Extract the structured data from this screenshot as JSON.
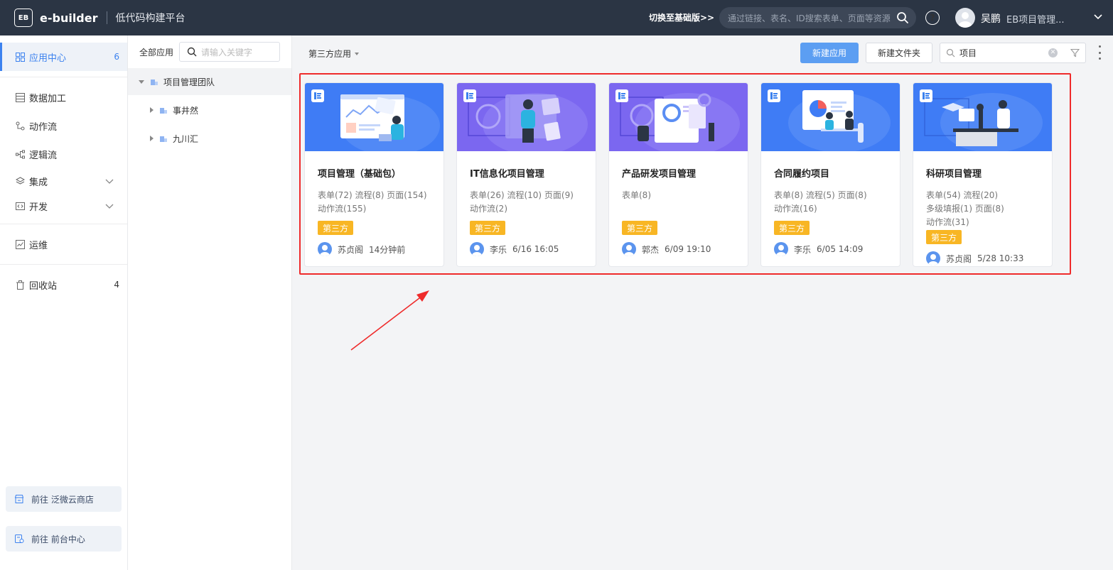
{
  "topbar": {
    "logo_text": "EB",
    "brand": "e-builder",
    "subtitle": "低代码构建平台",
    "switch_link": "切换至基础版>>",
    "search_placeholder": "通过链接、表名、ID搜索表单、页面等资源",
    "help_glyph": "?",
    "user_name": "吴鹏",
    "user_org": "EB项目管理..."
  },
  "sidebar": {
    "items": [
      {
        "label": "应用中心",
        "count": "6",
        "icon": "grid-icon"
      },
      {
        "label": "数据加工",
        "icon": "table-icon"
      },
      {
        "label": "动作流",
        "icon": "action-flow-icon"
      },
      {
        "label": "逻辑流",
        "icon": "logic-flow-icon"
      },
      {
        "label": "集成",
        "icon": "layers-icon"
      },
      {
        "label": "开发",
        "icon": "code-icon"
      },
      {
        "label": "运维",
        "icon": "chart-icon"
      },
      {
        "label": "回收站",
        "count": "4",
        "icon": "trash-icon"
      }
    ],
    "bottom_buttons": [
      {
        "label": "前往 泛微云商店",
        "icon": "store-icon"
      },
      {
        "label": "前往 前台中心",
        "icon": "frontdesk-icon"
      }
    ]
  },
  "tree": {
    "header_label": "全部应用",
    "search_placeholder": "请输入关键字",
    "nodes": [
      {
        "label": "项目管理团队"
      },
      {
        "label": "事井然"
      },
      {
        "label": "九川汇"
      }
    ]
  },
  "toolbar": {
    "filter_label": "第三方应用",
    "new_app": "新建应用",
    "new_folder": "新建文件夹",
    "search_value": "项目"
  },
  "cards": [
    {
      "title": "项目管理（基础包）",
      "stats": [
        "表单(72) 流程(8) 页面(154)",
        "动作流(155)"
      ],
      "tag": "第三方",
      "author": "苏贞阁",
      "time": "14分钟前"
    },
    {
      "title": "IT信息化项目管理",
      "stats": [
        "表单(26) 流程(10) 页面(9)",
        "动作流(2)"
      ],
      "tag": "第三方",
      "author": "李乐",
      "time": "6/16 16:05"
    },
    {
      "title": "产品研发项目管理",
      "stats": [
        "表单(8)"
      ],
      "tag": "第三方",
      "author": "郭杰",
      "time": "6/09 19:10"
    },
    {
      "title": "合同履约项目",
      "stats": [
        "表单(8) 流程(5) 页面(8)",
        "动作流(16)"
      ],
      "tag": "第三方",
      "author": "李乐",
      "time": "6/05 14:09"
    },
    {
      "title": "科研项目管理",
      "stats": [
        "表单(54) 流程(20)",
        "多级填报(1) 页面(8)",
        "动作流(31)"
      ],
      "tag": "第三方",
      "author": "苏贞阁",
      "time": "5/28 10:33"
    }
  ],
  "colors": {
    "topbar": "#2b3544",
    "accent": "#3c82ef",
    "primary_button": "#5c9ef2",
    "tag": "#f8b624",
    "highlight": "#ef2b2b",
    "banner_blue": "#3f7cf5",
    "banner_purple": "#7b67f0"
  }
}
